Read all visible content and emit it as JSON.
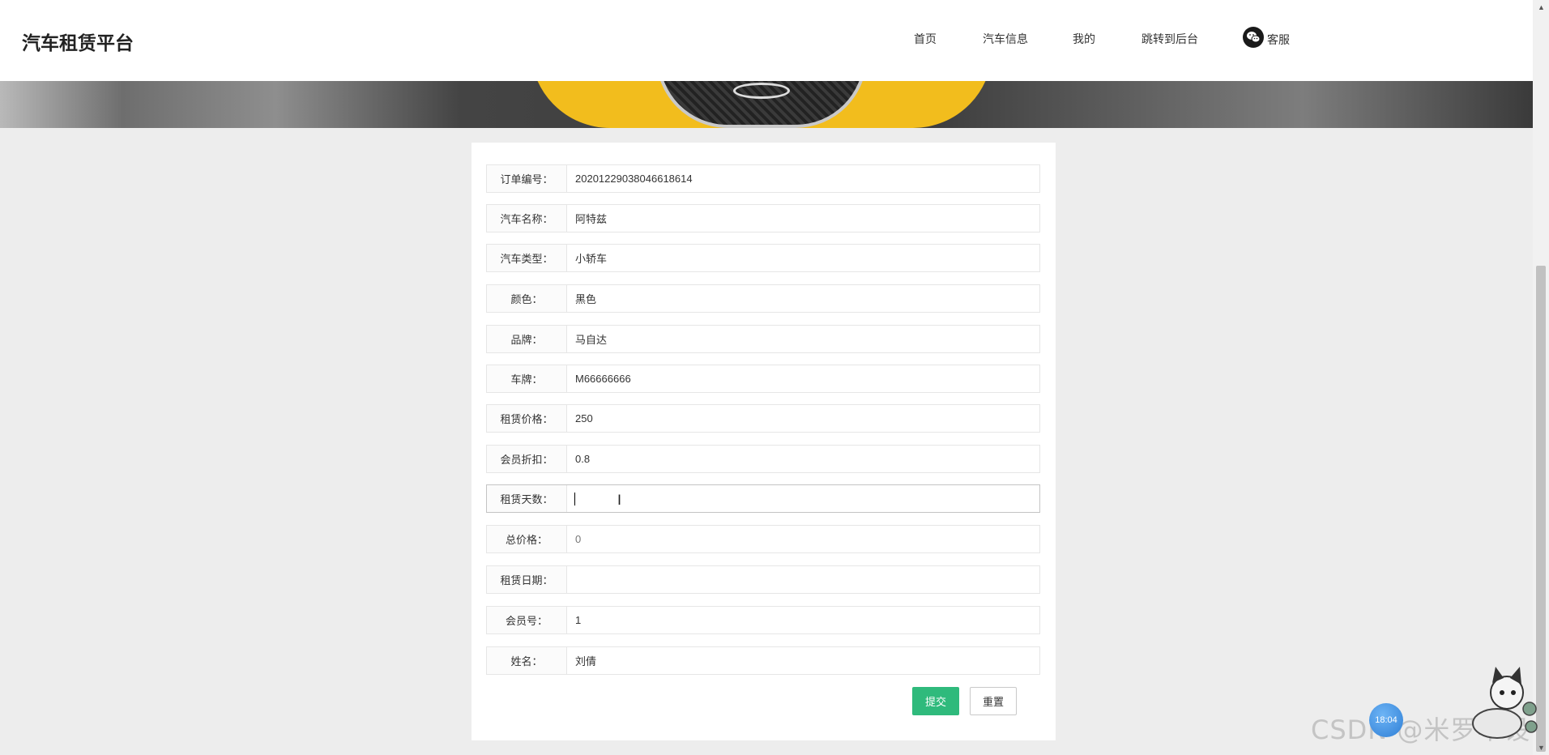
{
  "header": {
    "brand": "汽车租赁平台",
    "nav": [
      "首页",
      "汽车信息",
      "我的",
      "跳转到后台"
    ],
    "service_label": "客服"
  },
  "form": {
    "fields": [
      {
        "label": "订单编号：",
        "value": "20201229038046618614"
      },
      {
        "label": "汽车名称：",
        "value": "阿特兹"
      },
      {
        "label": "汽车类型：",
        "value": "小轿车"
      },
      {
        "label": "颜色：",
        "value": "黑色"
      },
      {
        "label": "品牌：",
        "value": "马自达"
      },
      {
        "label": "车牌：",
        "value": "M66666666"
      },
      {
        "label": "租赁价格：",
        "value": "250"
      },
      {
        "label": "会员折扣：",
        "value": "0.8"
      },
      {
        "label": "租赁天数：",
        "value": ""
      },
      {
        "label": "总价格：",
        "value": "0"
      },
      {
        "label": "租赁日期：",
        "value": ""
      },
      {
        "label": "会员号：",
        "value": "1"
      },
      {
        "label": "姓名：",
        "value": "刘倩"
      }
    ],
    "submit_label": "提交",
    "reset_label": "重置"
  },
  "overlay": {
    "bubble_text": "18:04",
    "watermark": "CSDN @米罗毕设"
  },
  "colors": {
    "submit_bg": "#2fba7c",
    "page_bg": "#ededed"
  }
}
